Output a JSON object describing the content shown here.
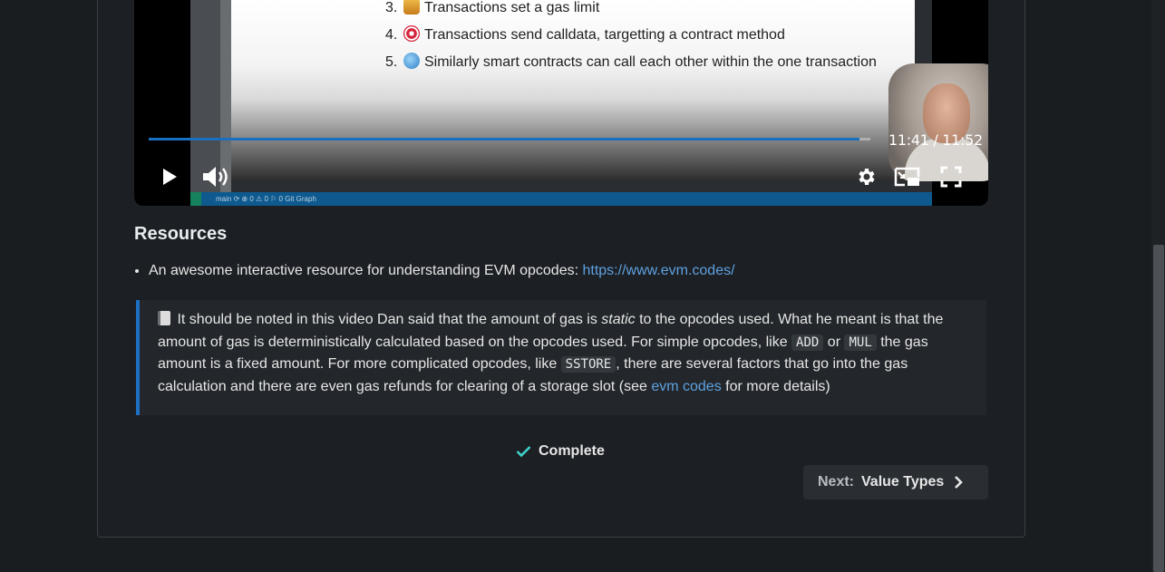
{
  "video": {
    "slide_items": [
      {
        "num": "3.",
        "text": "Transactions set a gas limit",
        "icon": "gas-pump-emoji"
      },
      {
        "num": "4.",
        "text": "Transactions send calldata, targetting a contract method",
        "icon": "target-emoji"
      },
      {
        "num": "5.",
        "text": "Similarly smart contracts can call each other within the one transaction",
        "icon": "globe-emoji"
      }
    ],
    "statusbar": "main ⟳   ⊗ 0 ⚠ 0   ⚐ 0   Git Graph",
    "time_display": "11:41 / 11:52",
    "progress_fraction": 0.985,
    "controls": [
      "play-icon",
      "volume-icon",
      "settings-icon",
      "picture-in-picture-icon",
      "fullscreen-icon"
    ]
  },
  "resources": {
    "heading": "Resources",
    "item_text": "An awesome interactive resource for understanding EVM opcodes: ",
    "item_link": "https://www.evm.codes/"
  },
  "note": {
    "part1": " It should be noted in this video Dan said that the amount of gas is ",
    "emphasis": "static",
    "part2": " to the opcodes used. What he meant is that the amount of gas is deterministically calculated based on the opcodes used. For simple opcodes, like ",
    "code1": "ADD",
    "part3": " or ",
    "code2": "MUL",
    "part4": " the gas amount is a fixed amount. For more complicated opcodes, like ",
    "code3": "SSTORE",
    "part5": ", there are several factors that go into the gas calculation and there are even gas refunds for clearing of a storage slot (see ",
    "link": "evm codes",
    "part6": " for more details)"
  },
  "complete": {
    "label": "Complete"
  },
  "next": {
    "prefix": "Next:",
    "title": "Value Types"
  },
  "colors": {
    "accent": "#1d6fc4",
    "link": "#5ea1e0",
    "background": "#1a1d20"
  }
}
